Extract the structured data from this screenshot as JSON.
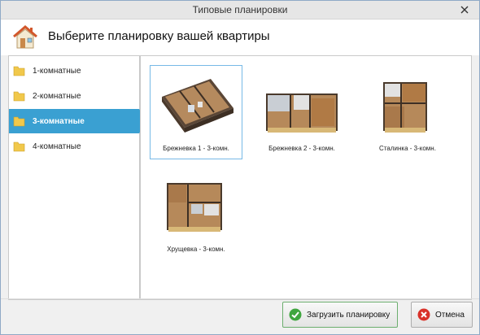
{
  "window": {
    "title": "Типовые планировки",
    "close_icon": "close-icon"
  },
  "header": {
    "title": "Выберите планировку вашей квартиры",
    "icon": "house-icon"
  },
  "sidebar": {
    "items": [
      {
        "label": "1-комнатные",
        "icon": "folder-icon",
        "active": false
      },
      {
        "label": "2-комнатные",
        "icon": "folder-icon",
        "active": false
      },
      {
        "label": "3-комнатные",
        "icon": "folder-icon",
        "active": true
      },
      {
        "label": "4-комнатные",
        "icon": "folder-icon",
        "active": false
      }
    ]
  },
  "plans": [
    {
      "caption": "Брежневка 1 - 3-комн.",
      "selected": true
    },
    {
      "caption": "Брежневка 2 - 3-комн.",
      "selected": false
    },
    {
      "caption": "Сталинка - 3-комн.",
      "selected": false
    },
    {
      "caption": "Хрущевка - 3-комн.",
      "selected": false
    }
  ],
  "buttons": {
    "load": {
      "label": "Загрузить планировку",
      "icon": "checkmark-icon"
    },
    "cancel": {
      "label": "Отмена",
      "icon": "cancel-icon"
    }
  },
  "colors": {
    "accent": "#3aa0d2",
    "selection_border": "#77b9e6",
    "folder": "#f1c84b"
  }
}
